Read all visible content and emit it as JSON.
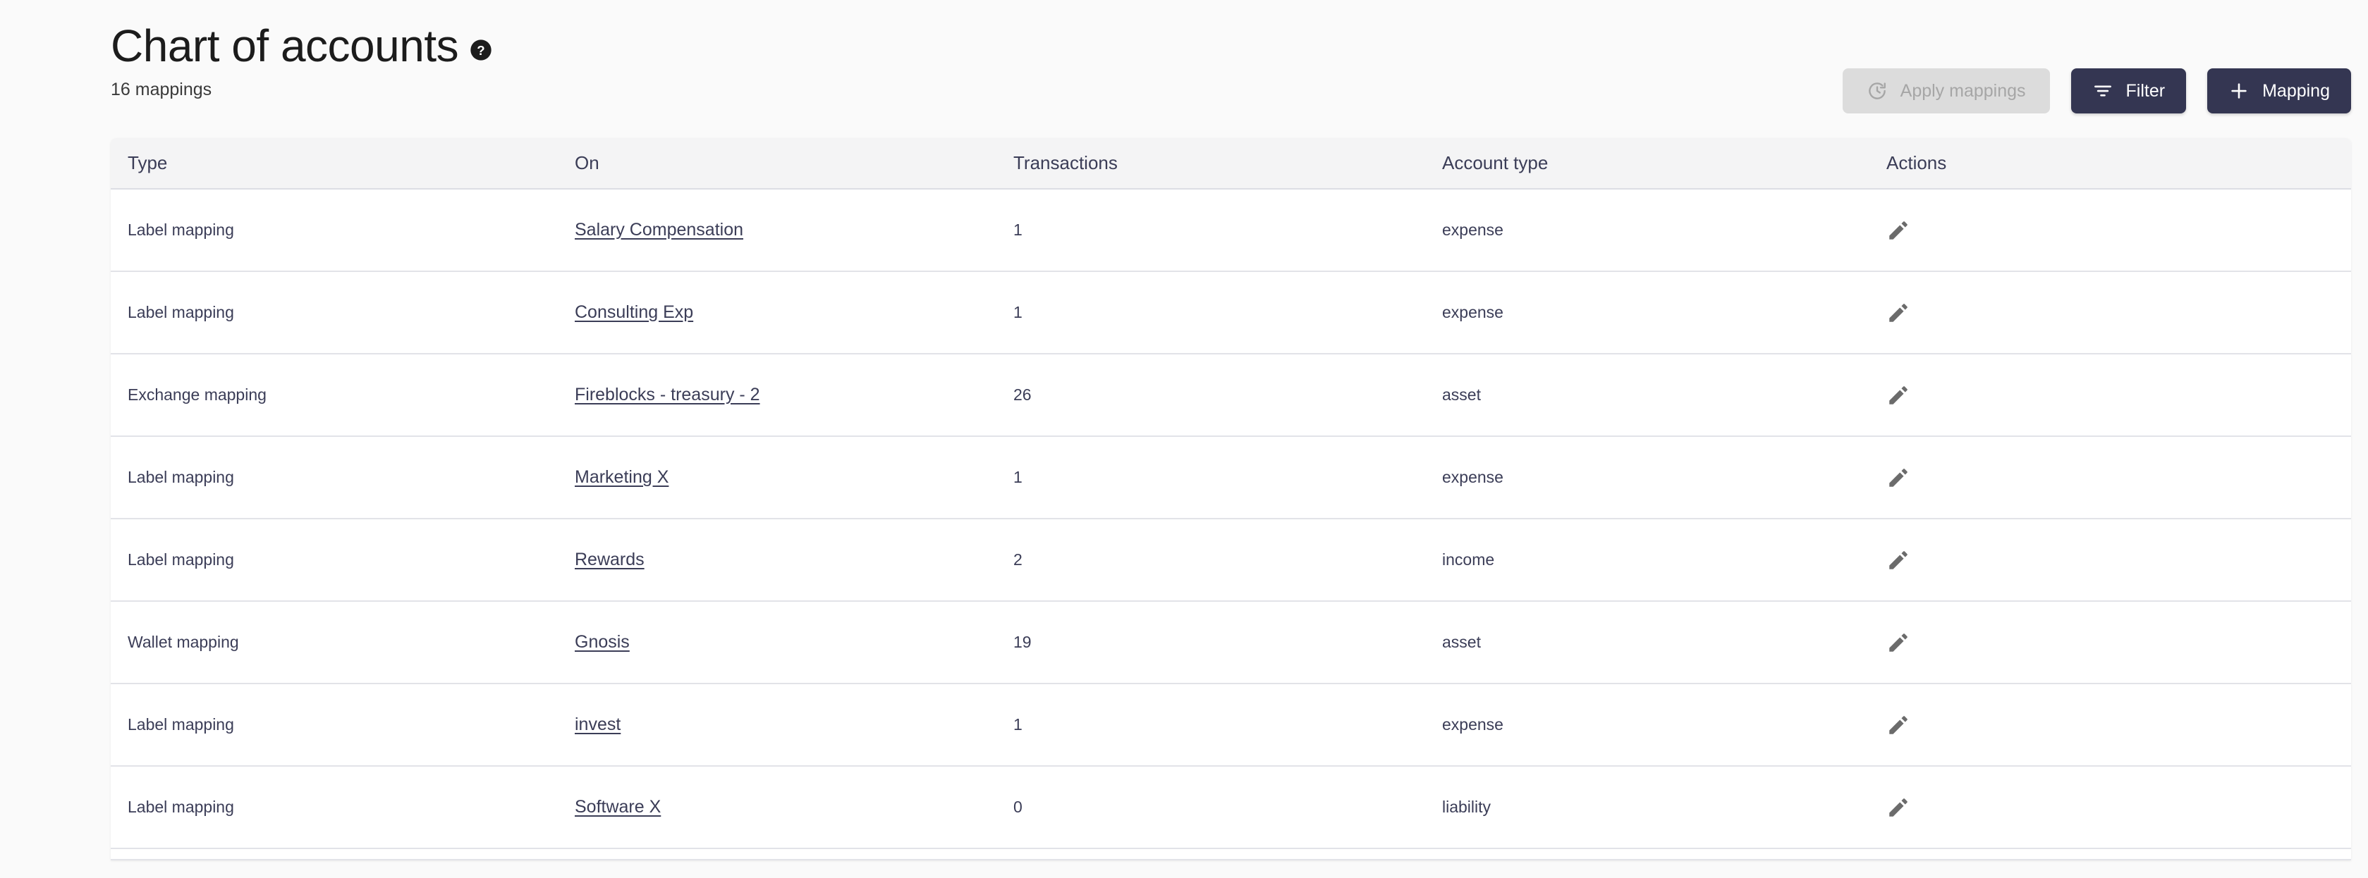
{
  "header": {
    "title": "Chart of accounts",
    "help_icon": "help-circle-icon",
    "subtitle": "16 mappings",
    "actions": {
      "apply_mappings": {
        "label": "Apply mappings",
        "icon": "history-refresh-icon",
        "disabled": true
      },
      "filter": {
        "label": "Filter",
        "icon": "filter-icon"
      },
      "mapping": {
        "label": "Mapping",
        "icon": "plus-icon"
      }
    }
  },
  "colors": {
    "page_background": "#fafafa",
    "primary_button": "#343652",
    "disabled_button": "#dcdcdc",
    "disabled_button_text": "#a6a6a6",
    "table_header_background": "#f4f4f5",
    "text": "#3b3d57",
    "title_text": "#1c1c1c",
    "row_border": "#e2e3e8",
    "pencil_icon": "#6b6b6b"
  },
  "table": {
    "columns": [
      "Type",
      "On",
      "Transactions",
      "Account type",
      "Actions"
    ],
    "row_action_icon": "pencil-icon",
    "rows": [
      {
        "type": "Label mapping",
        "on": "Salary Compensation",
        "transactions": "1",
        "account_type": "expense"
      },
      {
        "type": "Label mapping",
        "on": "Consulting Exp",
        "transactions": "1",
        "account_type": "expense"
      },
      {
        "type": "Exchange mapping",
        "on": "Fireblocks - treasury - 2",
        "transactions": "26",
        "account_type": "asset"
      },
      {
        "type": "Label mapping",
        "on": "Marketing X",
        "transactions": "1",
        "account_type": "expense"
      },
      {
        "type": "Label mapping",
        "on": "Rewards",
        "transactions": "2",
        "account_type": "income"
      },
      {
        "type": "Wallet mapping",
        "on": "Gnosis",
        "transactions": "19",
        "account_type": "asset"
      },
      {
        "type": "Label mapping",
        "on": "invest",
        "transactions": "1",
        "account_type": "expense"
      },
      {
        "type": "Label mapping",
        "on": "Software X",
        "transactions": "0",
        "account_type": "liability"
      }
    ]
  }
}
